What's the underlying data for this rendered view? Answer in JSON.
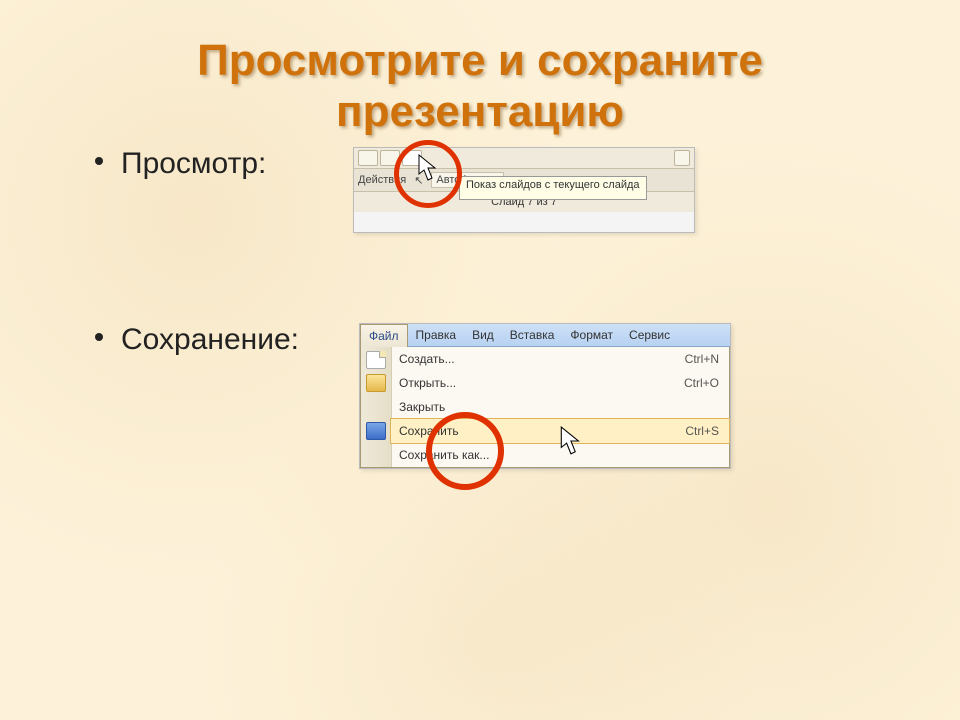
{
  "title_line1": "Просмотрите и сохраните",
  "title_line2": "презентацию",
  "bullets": {
    "view": "Просмотр:",
    "save": "Сохранение:"
  },
  "clip_view": {
    "actions_label": "Действия",
    "autoshapes_label": "Автофигуры",
    "tooltip": "Показ слайдов с текущего слайда",
    "statusbar": "Слайд 7 из 7"
  },
  "clip_save": {
    "menubar": [
      "Файл",
      "Правка",
      "Вид",
      "Вставка",
      "Формат",
      "Сервис"
    ],
    "rows": [
      {
        "icon": "new",
        "label": "Создать...",
        "shortcut": "Ctrl+N"
      },
      {
        "icon": "open",
        "label": "Открыть...",
        "shortcut": "Ctrl+O"
      },
      {
        "icon": "",
        "label": "Закрыть",
        "shortcut": ""
      },
      {
        "icon": "save",
        "label": "Сохранить",
        "shortcut": "Ctrl+S",
        "highlight": true
      },
      {
        "icon": "",
        "label": "Сохранить как...",
        "shortcut": ""
      }
    ]
  }
}
